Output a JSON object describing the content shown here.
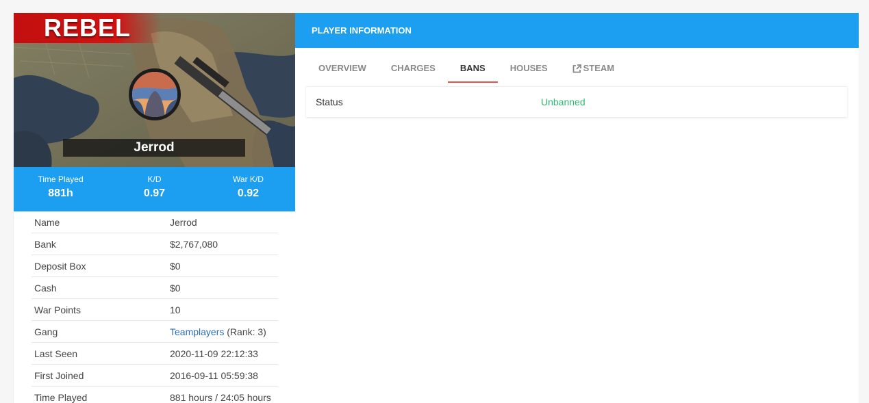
{
  "profile": {
    "faction": "REBEL",
    "name": "Jerrod",
    "stats": [
      {
        "label": "Time Played",
        "value": "881h"
      },
      {
        "label": "K/D",
        "value": "0.97"
      },
      {
        "label": "War K/D",
        "value": "0.92"
      }
    ],
    "details": [
      {
        "key": "Name",
        "value": "Jerrod"
      },
      {
        "key": "Bank",
        "value": "$2,767,080"
      },
      {
        "key": "Deposit Box",
        "value": "$0"
      },
      {
        "key": "Cash",
        "value": "$0"
      },
      {
        "key": "War Points",
        "value": "10"
      },
      {
        "key": "Gang",
        "link": "Teamplayers",
        "suffix": " (Rank: 3)"
      },
      {
        "key": "Last Seen",
        "value": "2020-11-09 22:12:33"
      },
      {
        "key": "First Joined",
        "value": "2016-09-11 05:59:38"
      },
      {
        "key": "Time Played",
        "value": "881 hours / 24:05 hours"
      }
    ]
  },
  "panel": {
    "title": "PLAYER INFORMATION",
    "tabs": [
      {
        "label": "OVERVIEW"
      },
      {
        "label": "CHARGES"
      },
      {
        "label": "BANS"
      },
      {
        "label": "HOUSES"
      },
      {
        "label": "STEAM",
        "icon": "external-link-icon"
      }
    ],
    "active_tab": "BANS",
    "bans": {
      "status_label": "Status",
      "status_value": "Unbanned"
    }
  },
  "colors": {
    "accent": "#1c9ef1",
    "faction": "#c20f0f",
    "tab_underline": "#e5534b",
    "unbanned": "#2eb872",
    "link": "#2b6cb8"
  }
}
